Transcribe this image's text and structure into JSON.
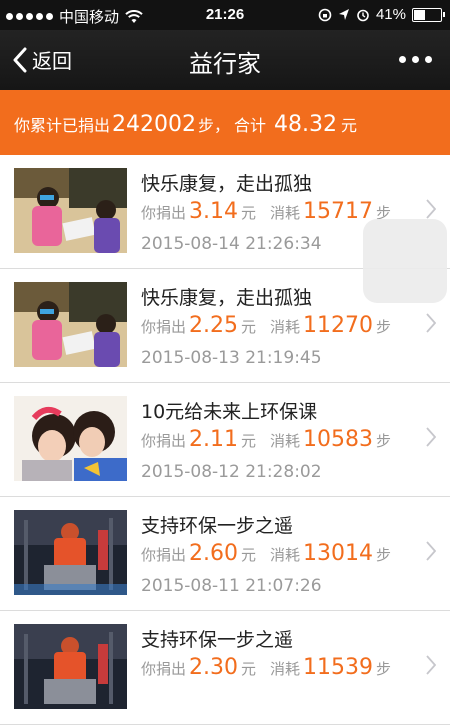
{
  "status_bar": {
    "carrier": "中国移动",
    "time": "21:26",
    "battery": "41%",
    "battery_level": 0.41
  },
  "nav": {
    "back_label": "返回",
    "title": "益行家"
  },
  "summary": {
    "prefix": "你累计已捐出",
    "steps": "242002",
    "steps_unit": "步，",
    "total_label": "合计",
    "amount": "48.32",
    "amount_unit": "元"
  },
  "items": [
    {
      "title": "快乐康复，走出孤独",
      "donate_label": "你捐出",
      "amount": "3.14",
      "amount_unit": "元",
      "consume_label": "消耗",
      "steps": "15717",
      "steps_unit": "步",
      "date": "2015-08-14 21:26:34",
      "thumb": "children-classroom"
    },
    {
      "title": "快乐康复，走出孤独",
      "donate_label": "你捐出",
      "amount": "2.25",
      "amount_unit": "元",
      "consume_label": "消耗",
      "steps": "11270",
      "steps_unit": "步",
      "date": "2015-08-13 21:19:45",
      "thumb": "children-classroom"
    },
    {
      "title": "10元给未来上环保课",
      "donate_label": "你捐出",
      "amount": "2.11",
      "amount_unit": "元",
      "consume_label": "消耗",
      "steps": "10583",
      "steps_unit": "步",
      "date": "2015-08-12 21:28:02",
      "thumb": "two-girls"
    },
    {
      "title": "支持环保一步之遥",
      "donate_label": "你捐出",
      "amount": "2.60",
      "amount_unit": "元",
      "consume_label": "消耗",
      "steps": "13014",
      "steps_unit": "步",
      "date": "2015-08-11 21:07:26",
      "thumb": "street-cleaner"
    },
    {
      "title": "支持环保一步之遥",
      "donate_label": "你捐出",
      "amount": "2.30",
      "amount_unit": "元",
      "consume_label": "消耗",
      "steps": "11539",
      "steps_unit": "步",
      "date": "",
      "thumb": "street-cleaner"
    }
  ],
  "colors": {
    "accent": "#f26d1d",
    "navbar": "#1c1c1c"
  }
}
